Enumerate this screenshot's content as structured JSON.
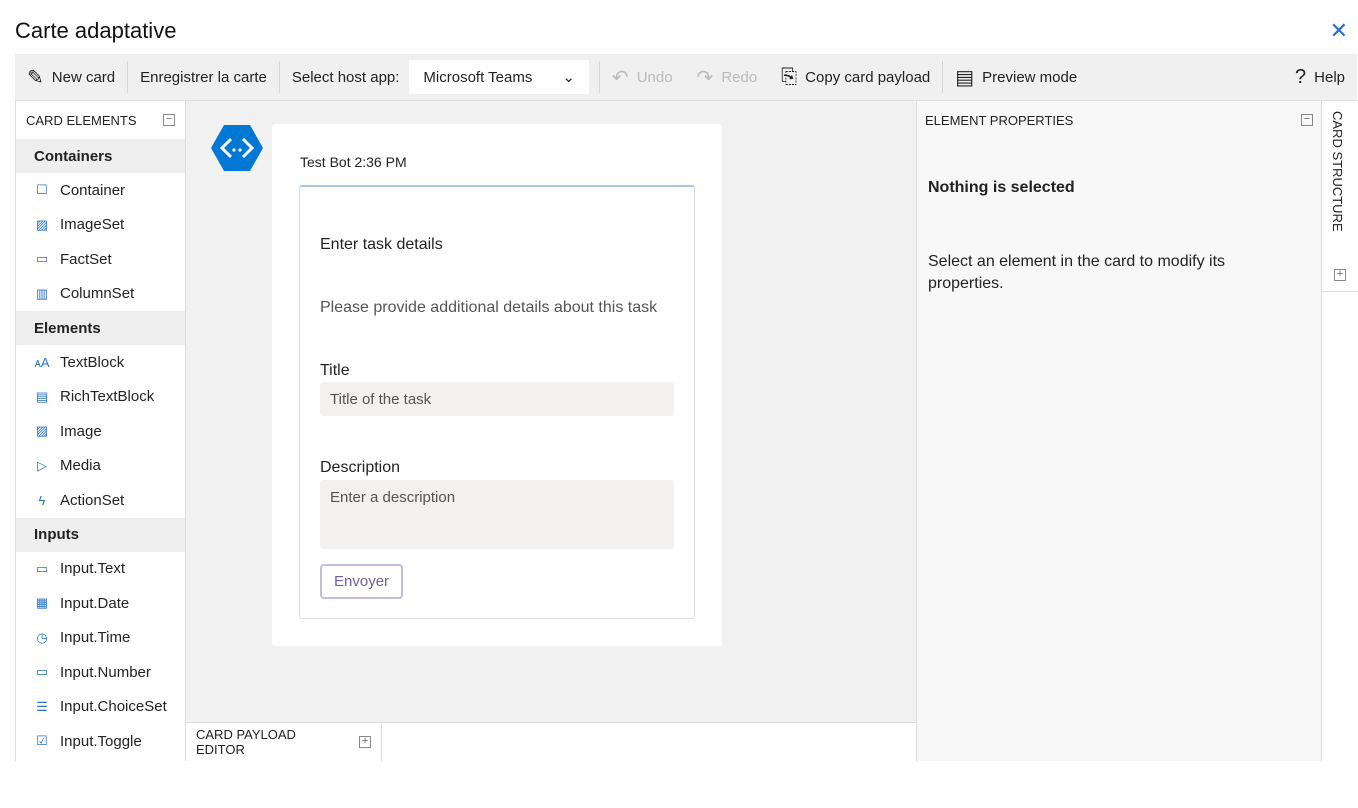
{
  "window": {
    "title": "Carte adaptative",
    "close": "✕"
  },
  "toolbar": {
    "new_card": "New card",
    "save": "Enregistrer la carte",
    "host_label": "Select host app:",
    "host_value": "Microsoft Teams",
    "undo": "Undo",
    "redo": "Redo",
    "copy": "Copy card payload",
    "preview": "Preview mode",
    "help": "Help"
  },
  "elements_panel": {
    "title": "CARD ELEMENTS",
    "groups": [
      {
        "label": "Containers",
        "items": [
          {
            "label": "Container",
            "icon": "☐"
          },
          {
            "label": "ImageSet",
            "icon": "▨"
          },
          {
            "label": "FactSet",
            "icon": "▭"
          },
          {
            "label": "ColumnSet",
            "icon": "▥"
          }
        ]
      },
      {
        "label": "Elements",
        "items": [
          {
            "label": "TextBlock",
            "icon": "ᴀA"
          },
          {
            "label": "RichTextBlock",
            "icon": "▤"
          },
          {
            "label": "Image",
            "icon": "▨"
          },
          {
            "label": "Media",
            "icon": "▷"
          },
          {
            "label": "ActionSet",
            "icon": "ϟ"
          }
        ]
      },
      {
        "label": "Inputs",
        "items": [
          {
            "label": "Input.Text",
            "icon": "▭"
          },
          {
            "label": "Input.Date",
            "icon": "▦"
          },
          {
            "label": "Input.Time",
            "icon": "◷"
          },
          {
            "label": "Input.Number",
            "icon": "▭"
          },
          {
            "label": "Input.ChoiceSet",
            "icon": "☰"
          },
          {
            "label": "Input.Toggle",
            "icon": "☑"
          }
        ]
      }
    ]
  },
  "card": {
    "timestamp": "Test Bot 2:36 PM",
    "heading": "Enter task details",
    "subtitle": "Please provide additional details about this task",
    "title_label": "Title",
    "title_placeholder": "Title of the task",
    "desc_label": "Description",
    "desc_placeholder": "Enter a description",
    "submit": "Envoyer"
  },
  "properties": {
    "title": "ELEMENT PROPERTIES",
    "empty_heading": "Nothing is selected",
    "empty_text": "Select an element in the card to modify its properties."
  },
  "structure": {
    "title": "CARD STRUCTURE"
  },
  "payload": {
    "title": "CARD PAYLOAD EDITOR"
  },
  "colors": {
    "accent": "#0078d4",
    "icon": "#2b73c7"
  }
}
